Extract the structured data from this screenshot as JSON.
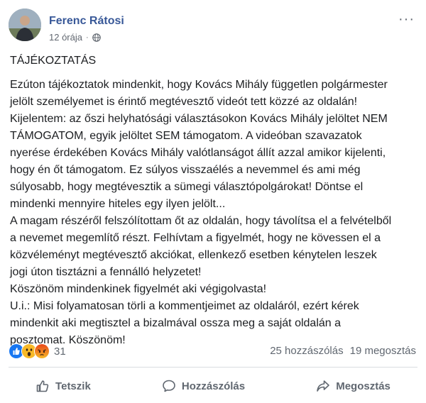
{
  "author": {
    "name": "Ferenc Rátosi",
    "time": "12 órája"
  },
  "post": {
    "title": "TÁJÉKOZTATÁS",
    "lines": [
      "Ezúton tájékoztatok mindenkit, hogy Kovács Mihály független polgármester",
      "jelölt személyemet is érintő megtévesztő videót tett közzé az oldalán!",
      "Kijelentem: az őszi helyhatósági választásokon Kovács Mihály jelöltet NEM",
      "TÁMOGATOM, egyik jelöltet SEM támogatom. A videóban szavazatok",
      "nyerése érdekében Kovács Mihály valótlanságot állít azzal amikor kijelenti,",
      "hogy én őt támogatom. Ez súlyos visszaélés a nevemmel és ami még",
      "súlyosabb, hogy megtévesztik a sümegi választópolgárokat! Döntse el",
      "mindenki mennyire hiteles egy ilyen jelölt...",
      "A magam részéről felszólítottam őt az oldalán, hogy távolítsa el a felvételből",
      "a nevemet megemlítő részt. Felhívtam a figyelmét, hogy ne kövessen el a",
      "közvéleményt megtévesztő akciókat, ellenkező esetben kénytelen leszek",
      "jogi úton tisztázni a fennálló helyzetet!",
      "Köszönöm mindenkinek figyelmét aki végigolvasta!",
      "U.i.: Misi folyamatosan törli a kommentjeimet az oldaláról, ezért kérek",
      "mindenkit aki megtisztel a bizalmával ossza meg a saját oldalán a",
      "posztomat. Köszönöm!"
    ]
  },
  "reactions": {
    "count": "31",
    "icons": [
      "like-icon",
      "wow-icon",
      "angry-icon"
    ]
  },
  "stats": {
    "comments": "25 hozzászólás",
    "shares": "19 megosztás"
  },
  "actions": {
    "like": "Tetszik",
    "comment": "Hozzászólás",
    "share": "Megosztás"
  },
  "colors": {
    "name": "#385898",
    "like": "#1877f2",
    "wow": "#f7b928",
    "angry": "#e9710f"
  }
}
